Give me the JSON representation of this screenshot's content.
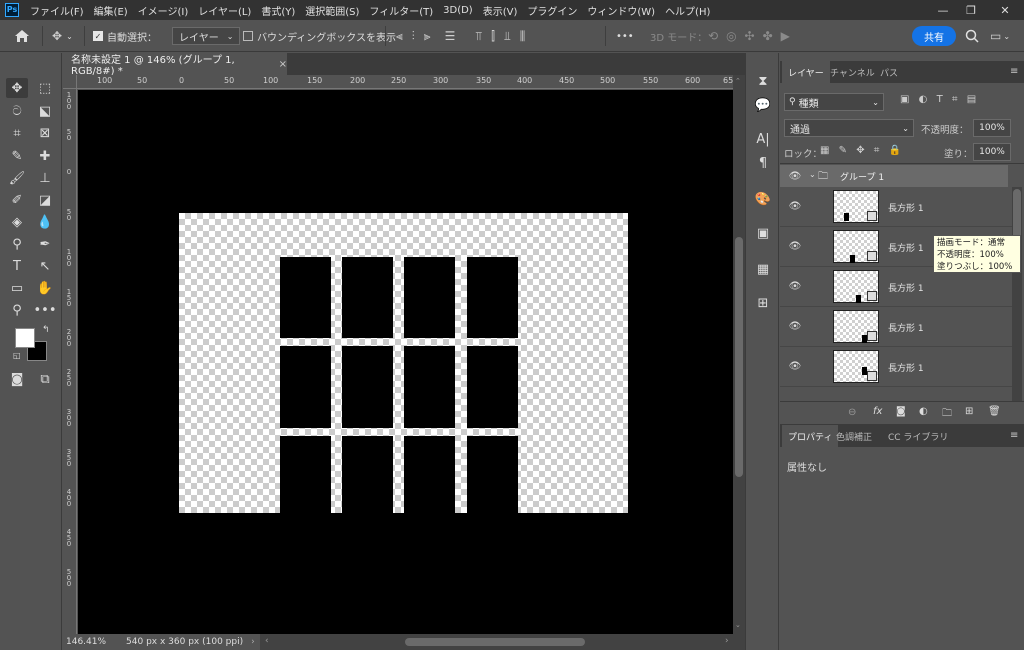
{
  "menu": {
    "logo": "Ps",
    "items": [
      "ファイル(F)",
      "編集(E)",
      "イメージ(I)",
      "レイヤー(L)",
      "書式(Y)",
      "選択範囲(S)",
      "フィルター(T)",
      "3D(D)",
      "表示(V)",
      "プラグイン",
      "ウィンドウ(W)",
      "ヘルプ(H)"
    ],
    "minimize": "—",
    "restore": "❐",
    "close": "✕"
  },
  "options": {
    "home_icon": "home-icon",
    "auto_select_label": "自動選択：",
    "auto_select_checked": "✓",
    "auto_select_target": "レイヤー",
    "bounding_box_label": "バウンディングボックスを表示",
    "more": "•••",
    "mode_3d": "3D モード：",
    "share": "共有"
  },
  "document": {
    "tab_title": "名称未設定 1 @ 146% (グループ 1, RGB/8#) *",
    "tab_close": "×"
  },
  "ruler_top": [
    "100",
    "50",
    "0",
    "50",
    "100",
    "150",
    "200",
    "250",
    "300",
    "350",
    "400",
    "450",
    "500",
    "550",
    "600",
    "65"
  ],
  "ruler_left": [
    "100",
    "50",
    "0",
    "50",
    "100",
    "150",
    "200",
    "250",
    "300",
    "350",
    "400",
    "450",
    "500"
  ],
  "status": {
    "zoom": "146.41%",
    "doc_size": "540 px x 360 px (100 ppi)",
    "arrow": "›"
  },
  "layers_panel": {
    "tabs": [
      "レイヤー",
      "チャンネル",
      "パス"
    ],
    "filter_label": "種類",
    "blend_mode": "通過",
    "opacity_label": "不透明度：",
    "opacity_value": "100%",
    "lock_label": "ロック：",
    "fill_label": "塗り：",
    "fill_value": "100%",
    "group_name": "グループ 1",
    "layers": [
      {
        "name": "長方形 1"
      },
      {
        "name": "長方形 1"
      },
      {
        "name": "長方形 1"
      },
      {
        "name": "長方形 1"
      },
      {
        "name": "長方形 1"
      }
    ],
    "tooltip": [
      "描画モード：通常",
      "不透明度：100%",
      "塗りつぶし：100%"
    ]
  },
  "properties_panel": {
    "tabs": [
      "プロパティ",
      "色調補正",
      "CC ライブラリ"
    ],
    "empty_text": "属性なし"
  },
  "colors": {
    "accent": "#1473e6",
    "panel": "#535353",
    "dark": "#323232"
  }
}
